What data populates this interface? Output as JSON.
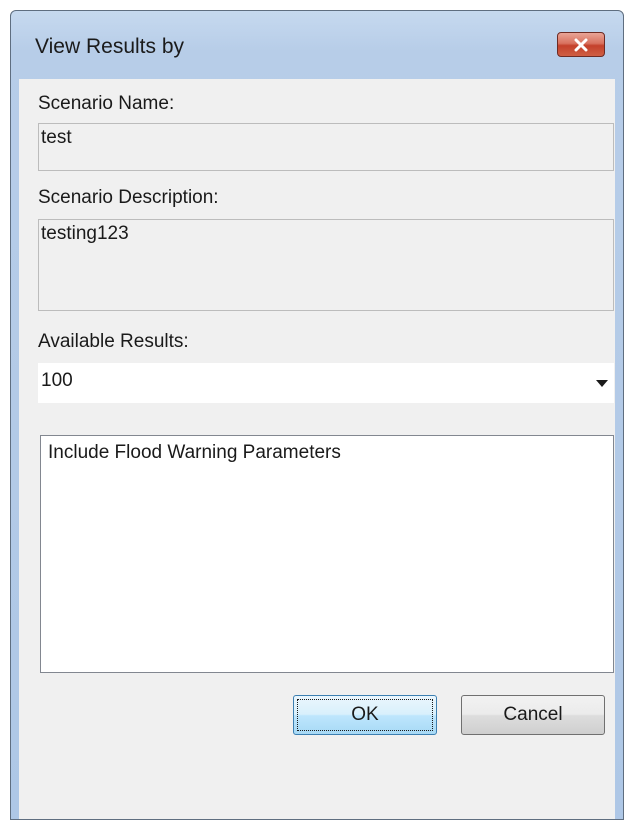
{
  "window": {
    "title": "View Results by",
    "close_icon": "close-icon"
  },
  "form": {
    "scenario_name_label": "Scenario Name:",
    "scenario_name_value": "test",
    "scenario_description_label": "Scenario Description:",
    "scenario_description_value": "testing123",
    "available_results_label": "Available Results:",
    "available_results_selected": "100",
    "listbox_items": [
      "Include Flood Warning Parameters"
    ]
  },
  "buttons": {
    "ok_label": "OK",
    "cancel_label": "Cancel"
  },
  "colors": {
    "title_bar": "#b7cde8",
    "close_button": "#c4412b",
    "dialog_background": "#f0f0f0"
  }
}
